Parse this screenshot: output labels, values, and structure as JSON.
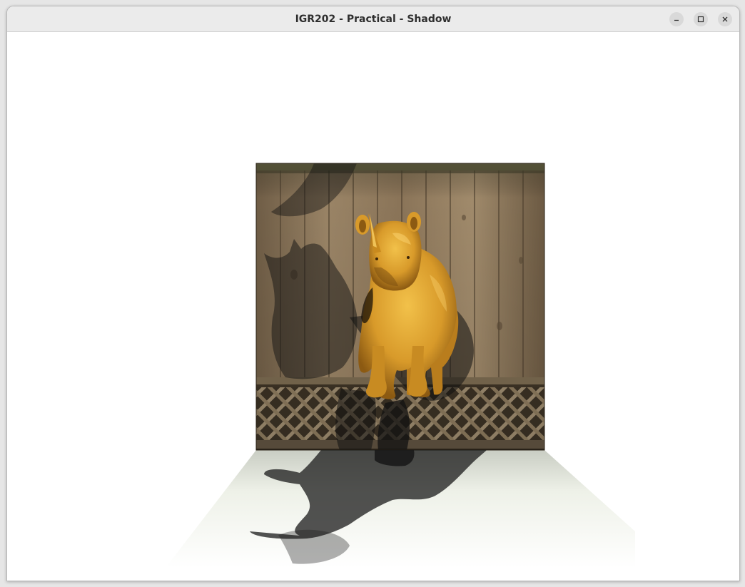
{
  "window": {
    "title": "IGR202 - Practical - Shadow",
    "controls": {
      "minimize": "minimize-icon",
      "maximize": "maximize-icon",
      "close": "close-icon"
    }
  },
  "scene": {
    "objects": [
      "wooden-fence-wall",
      "lattice-panel",
      "floor-plane",
      "rhino-model",
      "rhino-shadow-wall",
      "rhino-shadow-floor"
    ],
    "colors": {
      "rhino": "#d89a2a",
      "rhino_highlight": "#f2c14a",
      "wood": "#8a7458",
      "wood_dark": "#5a4a36",
      "floor": "#f3f5ee",
      "shadow": "#111111",
      "background": "#ffffff"
    }
  }
}
